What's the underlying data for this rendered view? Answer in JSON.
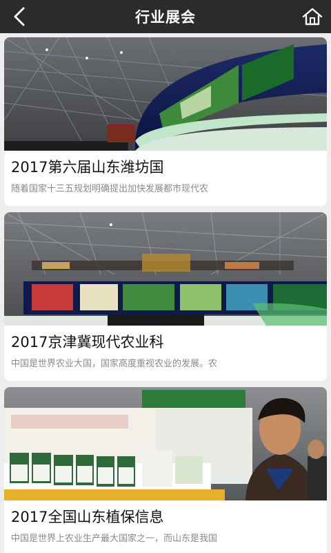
{
  "header": {
    "title": "行业展会"
  },
  "icons": {
    "back": "back-arrow-icon",
    "home": "home-icon"
  },
  "articles": [
    {
      "title": "2017第六届山东潍坊国",
      "desc": "随着国家十三五规划明确提出加快发展都市现代农"
    },
    {
      "title": "2017京津冀现代农业科",
      "desc": "中国是世界农业大国，国家高度重视农业的发展。农"
    },
    {
      "title": "2017全国山东植保信息",
      "desc": "中国是世界上农业生产最大国家之一，而山东是我国"
    }
  ],
  "colors": {
    "header_bg": "#2b2b2b",
    "page_bg": "#eeeeee",
    "card_bg": "#ffffff",
    "title_text": "#111111",
    "desc_text": "#8a8a8a"
  }
}
